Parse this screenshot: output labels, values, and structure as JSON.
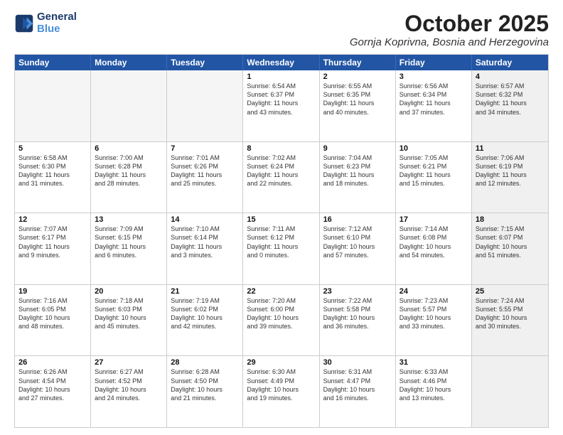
{
  "header": {
    "logo_line1": "General",
    "logo_line2": "Blue",
    "month_title": "October 2025",
    "subtitle": "Gornja Koprivna, Bosnia and Herzegovina"
  },
  "days_of_week": [
    "Sunday",
    "Monday",
    "Tuesday",
    "Wednesday",
    "Thursday",
    "Friday",
    "Saturday"
  ],
  "weeks": [
    [
      {
        "day": "",
        "text": "",
        "empty": true
      },
      {
        "day": "",
        "text": "",
        "empty": true
      },
      {
        "day": "",
        "text": "",
        "empty": true
      },
      {
        "day": "1",
        "text": "Sunrise: 6:54 AM\nSunset: 6:37 PM\nDaylight: 11 hours\nand 43 minutes.",
        "empty": false
      },
      {
        "day": "2",
        "text": "Sunrise: 6:55 AM\nSunset: 6:35 PM\nDaylight: 11 hours\nand 40 minutes.",
        "empty": false
      },
      {
        "day": "3",
        "text": "Sunrise: 6:56 AM\nSunset: 6:34 PM\nDaylight: 11 hours\nand 37 minutes.",
        "empty": false
      },
      {
        "day": "4",
        "text": "Sunrise: 6:57 AM\nSunset: 6:32 PM\nDaylight: 11 hours\nand 34 minutes.",
        "empty": false,
        "shaded": true
      }
    ],
    [
      {
        "day": "5",
        "text": "Sunrise: 6:58 AM\nSunset: 6:30 PM\nDaylight: 11 hours\nand 31 minutes.",
        "empty": false
      },
      {
        "day": "6",
        "text": "Sunrise: 7:00 AM\nSunset: 6:28 PM\nDaylight: 11 hours\nand 28 minutes.",
        "empty": false
      },
      {
        "day": "7",
        "text": "Sunrise: 7:01 AM\nSunset: 6:26 PM\nDaylight: 11 hours\nand 25 minutes.",
        "empty": false
      },
      {
        "day": "8",
        "text": "Sunrise: 7:02 AM\nSunset: 6:24 PM\nDaylight: 11 hours\nand 22 minutes.",
        "empty": false
      },
      {
        "day": "9",
        "text": "Sunrise: 7:04 AM\nSunset: 6:23 PM\nDaylight: 11 hours\nand 18 minutes.",
        "empty": false
      },
      {
        "day": "10",
        "text": "Sunrise: 7:05 AM\nSunset: 6:21 PM\nDaylight: 11 hours\nand 15 minutes.",
        "empty": false
      },
      {
        "day": "11",
        "text": "Sunrise: 7:06 AM\nSunset: 6:19 PM\nDaylight: 11 hours\nand 12 minutes.",
        "empty": false,
        "shaded": true
      }
    ],
    [
      {
        "day": "12",
        "text": "Sunrise: 7:07 AM\nSunset: 6:17 PM\nDaylight: 11 hours\nand 9 minutes.",
        "empty": false
      },
      {
        "day": "13",
        "text": "Sunrise: 7:09 AM\nSunset: 6:15 PM\nDaylight: 11 hours\nand 6 minutes.",
        "empty": false
      },
      {
        "day": "14",
        "text": "Sunrise: 7:10 AM\nSunset: 6:14 PM\nDaylight: 11 hours\nand 3 minutes.",
        "empty": false
      },
      {
        "day": "15",
        "text": "Sunrise: 7:11 AM\nSunset: 6:12 PM\nDaylight: 11 hours\nand 0 minutes.",
        "empty": false
      },
      {
        "day": "16",
        "text": "Sunrise: 7:12 AM\nSunset: 6:10 PM\nDaylight: 10 hours\nand 57 minutes.",
        "empty": false
      },
      {
        "day": "17",
        "text": "Sunrise: 7:14 AM\nSunset: 6:08 PM\nDaylight: 10 hours\nand 54 minutes.",
        "empty": false
      },
      {
        "day": "18",
        "text": "Sunrise: 7:15 AM\nSunset: 6:07 PM\nDaylight: 10 hours\nand 51 minutes.",
        "empty": false,
        "shaded": true
      }
    ],
    [
      {
        "day": "19",
        "text": "Sunrise: 7:16 AM\nSunset: 6:05 PM\nDaylight: 10 hours\nand 48 minutes.",
        "empty": false
      },
      {
        "day": "20",
        "text": "Sunrise: 7:18 AM\nSunset: 6:03 PM\nDaylight: 10 hours\nand 45 minutes.",
        "empty": false
      },
      {
        "day": "21",
        "text": "Sunrise: 7:19 AM\nSunset: 6:02 PM\nDaylight: 10 hours\nand 42 minutes.",
        "empty": false
      },
      {
        "day": "22",
        "text": "Sunrise: 7:20 AM\nSunset: 6:00 PM\nDaylight: 10 hours\nand 39 minutes.",
        "empty": false
      },
      {
        "day": "23",
        "text": "Sunrise: 7:22 AM\nSunset: 5:58 PM\nDaylight: 10 hours\nand 36 minutes.",
        "empty": false
      },
      {
        "day": "24",
        "text": "Sunrise: 7:23 AM\nSunset: 5:57 PM\nDaylight: 10 hours\nand 33 minutes.",
        "empty": false
      },
      {
        "day": "25",
        "text": "Sunrise: 7:24 AM\nSunset: 5:55 PM\nDaylight: 10 hours\nand 30 minutes.",
        "empty": false,
        "shaded": true
      }
    ],
    [
      {
        "day": "26",
        "text": "Sunrise: 6:26 AM\nSunset: 4:54 PM\nDaylight: 10 hours\nand 27 minutes.",
        "empty": false
      },
      {
        "day": "27",
        "text": "Sunrise: 6:27 AM\nSunset: 4:52 PM\nDaylight: 10 hours\nand 24 minutes.",
        "empty": false
      },
      {
        "day": "28",
        "text": "Sunrise: 6:28 AM\nSunset: 4:50 PM\nDaylight: 10 hours\nand 21 minutes.",
        "empty": false
      },
      {
        "day": "29",
        "text": "Sunrise: 6:30 AM\nSunset: 4:49 PM\nDaylight: 10 hours\nand 19 minutes.",
        "empty": false
      },
      {
        "day": "30",
        "text": "Sunrise: 6:31 AM\nSunset: 4:47 PM\nDaylight: 10 hours\nand 16 minutes.",
        "empty": false
      },
      {
        "day": "31",
        "text": "Sunrise: 6:33 AM\nSunset: 4:46 PM\nDaylight: 10 hours\nand 13 minutes.",
        "empty": false
      },
      {
        "day": "",
        "text": "",
        "empty": true,
        "shaded": true
      }
    ]
  ]
}
